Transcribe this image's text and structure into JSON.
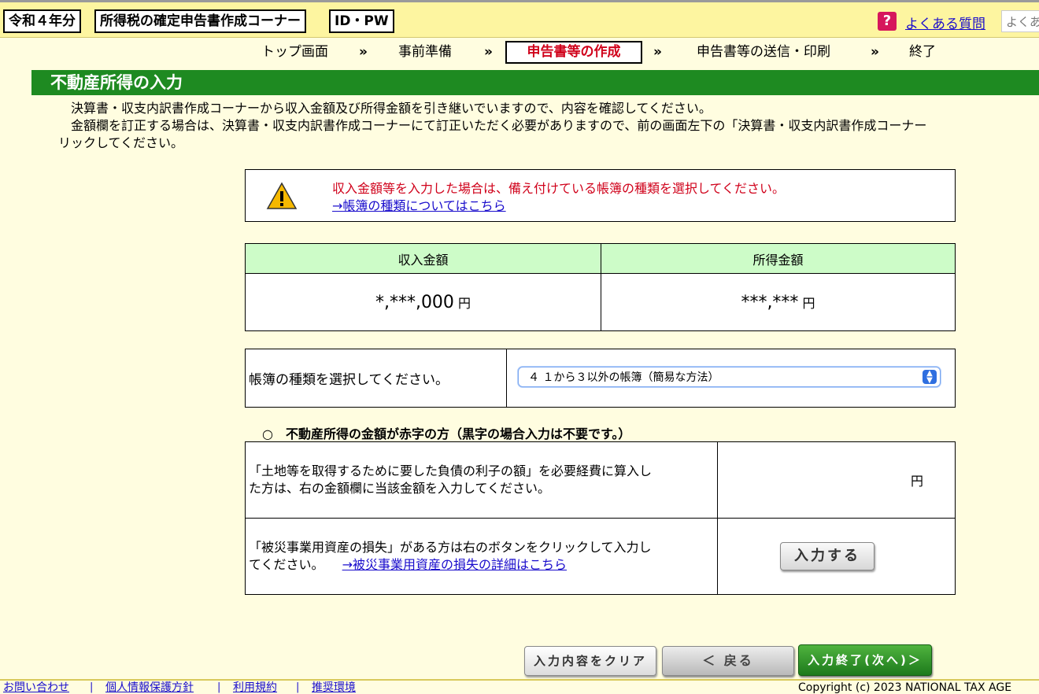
{
  "header": {
    "year_label": "令和４年分",
    "corner_label": "所得税の確定申告書作成コーナー",
    "idpw_label": "ID・PW",
    "help_icon": "question-icon",
    "help_icon_glyph": "?",
    "help_link": "よくある質問",
    "search_text": "よくあ"
  },
  "steps": {
    "items": [
      "トップ画面",
      "事前準備",
      "申告書等の作成",
      "申告書等の送信・印刷",
      "終了"
    ],
    "separator": "»",
    "active_index": 2
  },
  "page_title": "不動産所得の入力",
  "intro": {
    "line1": "決算書・収支内訳書作成コーナーから収入金額及び所得金額を引き継いでいますので、内容を確認してください。",
    "line2": "金額欄を訂正する場合は、決算書・収支内訳書作成コーナーにて訂正いただく必要がありますので、前の画面左下の「決算書・収支内訳書作成コーナー",
    "line3": "リックしてください。"
  },
  "warning": {
    "icon": "warning-icon",
    "message": "収入金額等を入力した場合は、備え付けている帳簿の種類を選択してください。",
    "link": "→帳簿の種類についてはこちら"
  },
  "amounts": {
    "revenue_header": "収入金額",
    "income_header": "所得金額",
    "revenue_value": "*,***,000",
    "income_value": "***,***",
    "unit": "円"
  },
  "ledger": {
    "label": "帳簿の種類を選択してください。",
    "selected": "４ １から３以外の帳簿（簡易な方法）"
  },
  "deficit": {
    "title": "○　不動産所得の金額が赤字の方（黒字の場合入力は不要です。）",
    "q1_line1": "「土地等を取得するために要した負債の利子の額」を必要経費に算入し",
    "q1_line2": "た方は、右の金額欄に当該金額を入力してください。",
    "q1_unit": "円",
    "q2_line1": "「被災事業用資産の損失」がある方は右のボタンをクリックして入力し",
    "q2_line2": "てください。",
    "q2_link": "→被災事業用資産の損失の詳細はこちら",
    "input_button": "入力する"
  },
  "buttons": {
    "clear": "入力内容をクリア",
    "back": "＜ 戻る",
    "next": "入力終了(次へ)＞"
  },
  "footer": {
    "links": [
      "お問い合わせ",
      "個人情報保護方針",
      "利用規約",
      "推奨環境"
    ],
    "separator": "|",
    "copyright": "Copyright (c) 2023 NATIONAL TAX AGE"
  },
  "colors": {
    "heading_green": "#1e8a21",
    "alert_red": "#d0021b",
    "link_blue": "#1a0dcc",
    "table_header_green": "#cdfcc8",
    "page_background": "#fffde0"
  }
}
